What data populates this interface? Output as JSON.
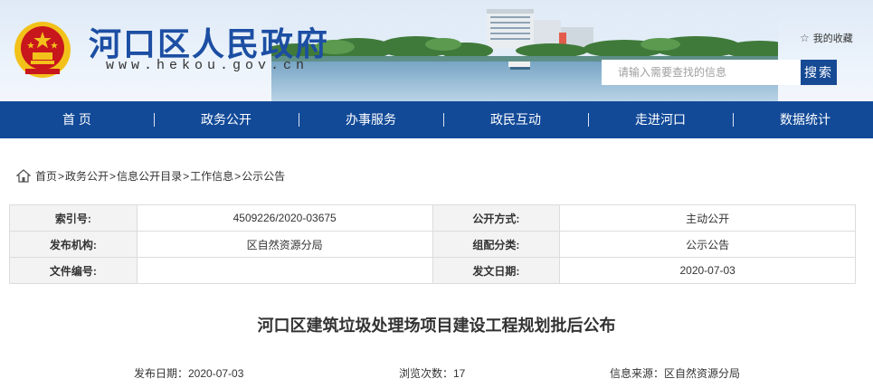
{
  "header": {
    "site_title": "河口区人民政府",
    "site_url": "www.hekou.gov.cn",
    "favorite_label": "我的收藏",
    "search_placeholder": "请输入需要查找的信息",
    "search_button": "搜索"
  },
  "nav": {
    "items": [
      "首 页",
      "政务公开",
      "办事服务",
      "政民互动",
      "走进河口",
      "数据统计"
    ]
  },
  "breadcrumb": {
    "items": [
      "首页",
      "政务公开",
      "信息公开目录",
      "工作信息",
      "公示公告"
    ],
    "separator": ">"
  },
  "info": {
    "rows": [
      {
        "label1": "索引号:",
        "value1": "4509226/2020-03675",
        "label2": "公开方式:",
        "value2": "主动公开"
      },
      {
        "label1": "发布机构:",
        "value1": "区自然资源分局",
        "label2": "组配分类:",
        "value2": "公示公告"
      },
      {
        "label1": "文件编号:",
        "value1": "",
        "label2": "发文日期:",
        "value2": "2020-07-03"
      }
    ]
  },
  "article": {
    "title": "河口区建筑垃圾处理场项目建设工程规划批后公布",
    "publish_date": "发布日期：2020-07-03",
    "views": "浏览次数：17",
    "source": "信息来源：区自然资源分局"
  },
  "colors": {
    "brand_blue": "#124a98",
    "title_blue": "#1c4ea3",
    "emblem_red": "#c8161d",
    "emblem_gold": "#f2c21b"
  }
}
